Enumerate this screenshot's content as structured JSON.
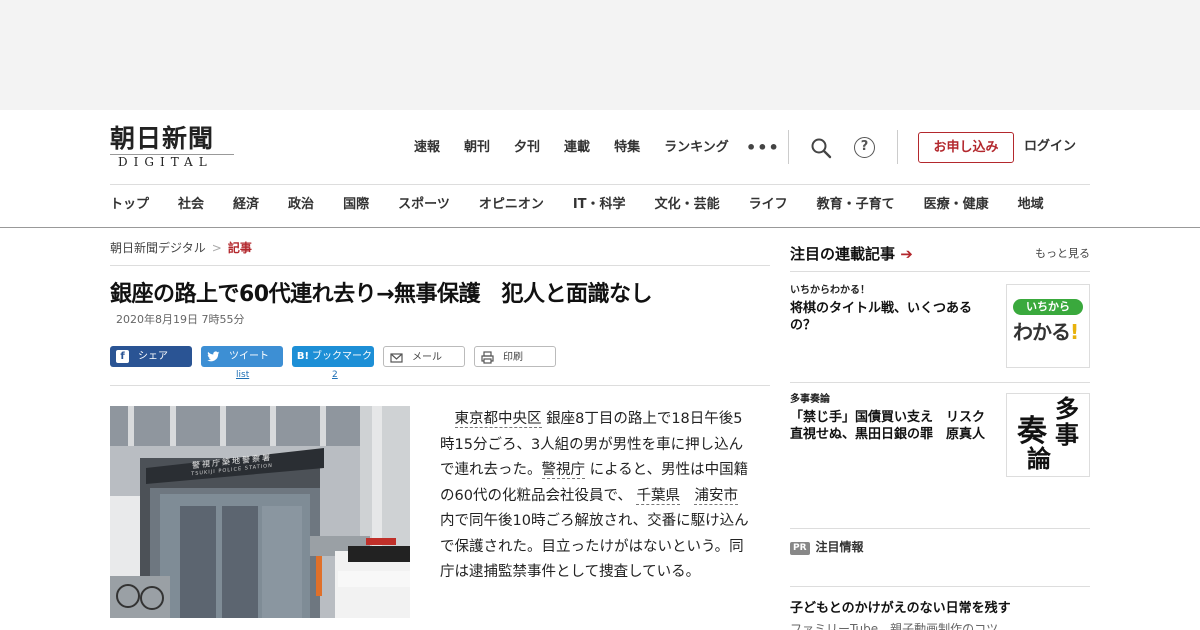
{
  "header": {
    "logo_main": "朝日新聞",
    "logo_sub": "DIGITAL",
    "top_nav": [
      "速報",
      "朝刊",
      "夕刊",
      "連載",
      "特集",
      "ランキング"
    ],
    "more_dots": "•••",
    "help_glyph": "?",
    "apply_label": "お申し込み",
    "login_label": "ログイン"
  },
  "category_nav": [
    "トップ",
    "社会",
    "経済",
    "政治",
    "国際",
    "スポーツ",
    "オピニオン",
    "IT・科学",
    "文化・芸能",
    "ライフ",
    "教育・子育て",
    "医療・健康",
    "地域"
  ],
  "article": {
    "breadcrumb_home": "朝日新聞デジタル",
    "breadcrumb_sep": ">",
    "breadcrumb_current": "記事",
    "headline": "銀座の路上で60代連れ去り→無事保護　犯人と面識なし",
    "date": "2020年8月19日 7時55分",
    "share": {
      "facebook": "シェア",
      "facebook_icon": "f",
      "twitter": "ツイート",
      "twitter_count": "list",
      "hatena": "ブックマーク",
      "hatena_icon": "B!",
      "hatena_count": "2",
      "mail": "メール",
      "print": "印刷"
    },
    "photo_sign": "警視庁築地警察署",
    "photo_sign_en": "TSUKIJI POLICE STATION",
    "body": {
      "p1_link1": "東京都中央区",
      "p1_a": " 銀座8丁目の路上で18日午後5時15分ごろ、3人組の男が男性を車に押し込んで連れ去った。",
      "p1_link2": "警視庁",
      "p1_b": " によると、男性は中国籍の60代の化粧品会社役員で、",
      "p1_link3": "千葉県",
      "p1_link4": "浦安市",
      "p1_c": " 内で同午後10時ごろ解放され、交番に駆け込んで保護された。目立ったけがはないという。同庁は逮捕監禁事件として捜査している。"
    }
  },
  "sidebar": {
    "heading": "注目の連載記事",
    "heading_arrow": "➔",
    "more": "もっと見る",
    "items": [
      {
        "kicker": "いちからわかる！",
        "title": "将棋のタイトル戦、いくつあるの？",
        "thumb_top": "いちから",
        "thumb_main": "わかる",
        "thumb_mark": "!"
      },
      {
        "kicker": "多事奏論",
        "title": "「禁じ手」国債買い支え　リスク直視せぬ、黒田日銀の罪　原真人",
        "thumb_chars": [
          "多",
          "奏",
          "事",
          "論"
        ]
      }
    ],
    "pr_badge": "PR",
    "pr_label": "注目情報",
    "pr_title": "子どもとのかけがえのない日常を残す",
    "pr_sub": "ファミリーTube　親子動画制作のコツ"
  },
  "colors": {
    "brand_red": "#b3282d",
    "facebook": "#2a5494",
    "twitter": "#3d8fd4",
    "hatena": "#1d8fd6",
    "ichikara_green": "#3aa93d"
  }
}
